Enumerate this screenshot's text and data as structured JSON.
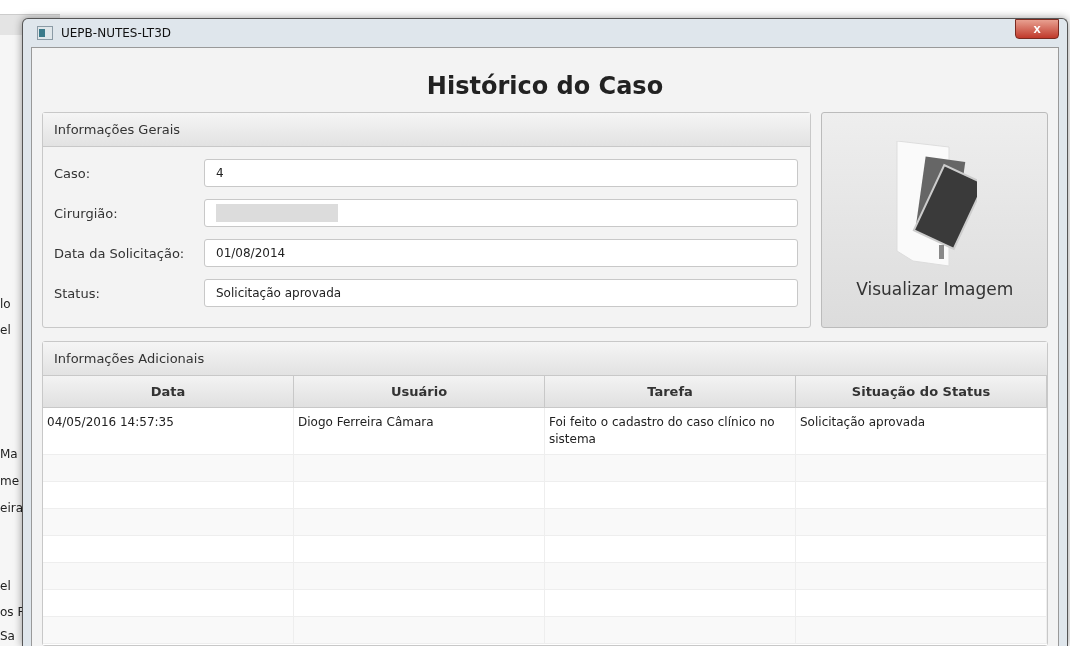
{
  "background_list": [
    "lo",
    "el",
    "Ma",
    "me",
    "eira",
    "el",
    "os F",
    "Sa"
  ],
  "window": {
    "title": "UEPB-NUTES-LT3D",
    "close": "x"
  },
  "heading": "Histórico do Caso",
  "general": {
    "title": "Informações Gerais",
    "fields": [
      {
        "label": "Caso:",
        "value": "4",
        "redacted": false
      },
      {
        "label": "Cirurgião:",
        "redacted": true
      },
      {
        "label": "Data da Solicitação:",
        "value": "01/08/2014",
        "redacted": false
      },
      {
        "label": "Status:",
        "value": "Solicitação aprovada",
        "redacted": false
      }
    ]
  },
  "view_button": {
    "label": "Visualizar Imagem"
  },
  "additional": {
    "title": "Informações Adicionais",
    "columns": [
      "Data",
      "Usuário",
      "Tarefa",
      "Situação do Status"
    ],
    "rows": [
      [
        "04/05/2016 14:57:35",
        "Diogo Ferreira Câmara",
        "Foi feito o cadastro do caso clínico no sistema",
        "Solicitação aprovada"
      ]
    ]
  }
}
